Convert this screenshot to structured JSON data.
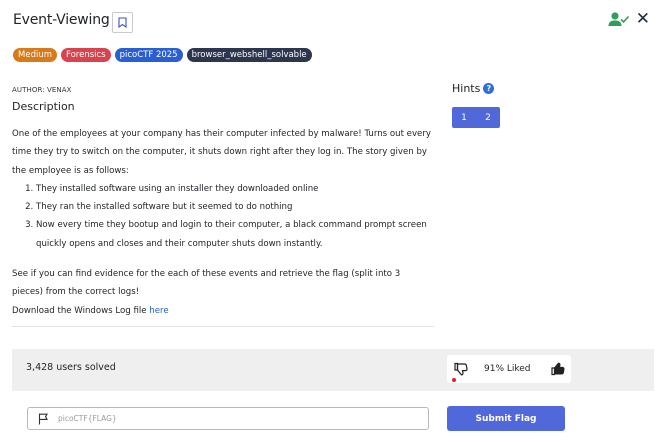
{
  "challenge": {
    "title": "Event-Viewing",
    "tags": [
      "Medium",
      "Forensics",
      "picoCTF 2025",
      "browser_webshell_solvable"
    ],
    "author": "AUTHOR: VENAX",
    "description_heading": "Description",
    "intro": "One of the employees at your company has their computer infected by malware! Turns out every time they try to switch on the computer, it shuts down right after they log in. The story given by the employee is as follows:",
    "steps": [
      "They installed software using an installer they downloaded online",
      "They ran the installed software but it seemed to do nothing",
      "Now every time they bootup and login to their computer, a black command prompt screen quickly opens and closes and their computer shuts down instantly."
    ],
    "task": "See if you can find evidence for the each of these events and retrieve the flag (split into 3 pieces) from the correct logs!",
    "download_prefix": "Download the Windows Log file ",
    "download_link": "here"
  },
  "hints": {
    "title": "Hints",
    "items": [
      "1",
      "2"
    ]
  },
  "stats": {
    "solved": "3,428 users solved",
    "liked": "91% Liked"
  },
  "flag": {
    "placeholder": "picoCTF{FLAG}",
    "submit_label": "Submit Flag"
  },
  "icons": {
    "bookmark": "bookmark-icon",
    "user_check": "user-check-icon",
    "close": "close-icon",
    "help": "help-icon",
    "dislike": "thumbs-down-icon",
    "like": "thumbs-up-icon",
    "flag": "flag-icon"
  },
  "colors": {
    "accent": "#5168db",
    "medium_tag": "#d97a1a",
    "forensics_tag": "#d9434d",
    "event_tag": "#2a5fd1",
    "solvable_tag": "#2d3650",
    "solved_check": "#2e9e5b"
  }
}
